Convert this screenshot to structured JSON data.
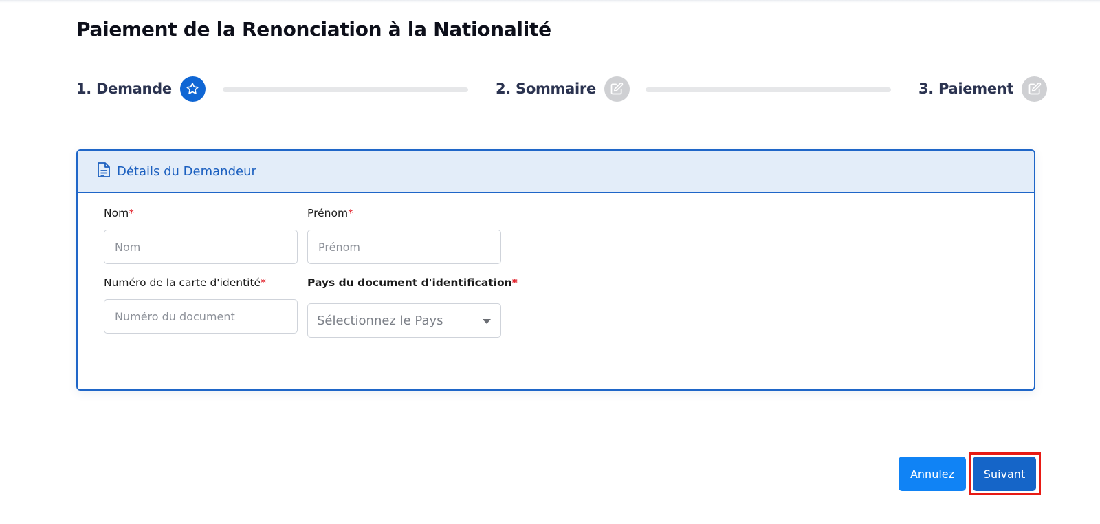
{
  "page": {
    "title": "Paiement de la Renonciation à la Nationalité"
  },
  "stepper": {
    "steps": [
      {
        "label": "1. Demande",
        "icon": "star-icon",
        "state": "active"
      },
      {
        "label": "2. Sommaire",
        "icon": "edit-icon",
        "state": "inactive"
      },
      {
        "label": "3. Paiement",
        "icon": "edit-icon",
        "state": "inactive"
      }
    ]
  },
  "card": {
    "title": "Détails du Demandeur",
    "icon": "document-icon"
  },
  "form": {
    "required_marker": "*",
    "nom": {
      "label": "Nom",
      "placeholder": "Nom",
      "value": ""
    },
    "prenom": {
      "label": "Prénom",
      "placeholder": "Prénom",
      "value": ""
    },
    "id_number": {
      "label": "Numéro de la carte d'identité",
      "placeholder": "Numéro du document",
      "value": ""
    },
    "country": {
      "label": "Pays du document d'identification",
      "selected": "Sélectionnez le Pays"
    }
  },
  "actions": {
    "cancel_label": "Annulez",
    "next_label": "Suivant"
  },
  "colors": {
    "primary": "#1565c8",
    "accent": "#1083f5",
    "header_bg": "#e3edf9",
    "required": "#e0151f",
    "highlight": "#e81a14",
    "inactive_step": "#cfd0d3"
  }
}
